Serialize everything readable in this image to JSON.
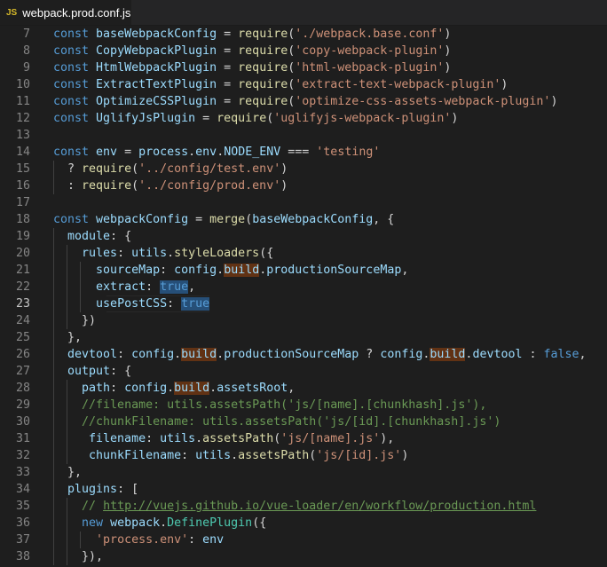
{
  "tab": {
    "icon": "JS",
    "title": "webpack.prod.conf.js"
  },
  "lines": [
    {
      "num": "7",
      "tokens": [
        [
          "kw",
          "const "
        ],
        [
          "var",
          "baseWebpackConfig"
        ],
        [
          "op",
          " = "
        ],
        [
          "fn",
          "require"
        ],
        [
          "op",
          "("
        ],
        [
          "str",
          "'./webpack.base.conf'"
        ],
        [
          "op",
          ")"
        ]
      ]
    },
    {
      "num": "8",
      "tokens": [
        [
          "kw",
          "const "
        ],
        [
          "var",
          "CopyWebpackPlugin"
        ],
        [
          "op",
          " = "
        ],
        [
          "fn",
          "require"
        ],
        [
          "op",
          "("
        ],
        [
          "str",
          "'copy-webpack-plugin'"
        ],
        [
          "op",
          ")"
        ]
      ]
    },
    {
      "num": "9",
      "tokens": [
        [
          "kw",
          "const "
        ],
        [
          "var",
          "HtmlWebpackPlugin"
        ],
        [
          "op",
          " = "
        ],
        [
          "fn",
          "require"
        ],
        [
          "op",
          "("
        ],
        [
          "str",
          "'html-webpack-plugin'"
        ],
        [
          "op",
          ")"
        ]
      ]
    },
    {
      "num": "10",
      "tokens": [
        [
          "kw",
          "const "
        ],
        [
          "var",
          "ExtractTextPlugin"
        ],
        [
          "op",
          " = "
        ],
        [
          "fn",
          "require"
        ],
        [
          "op",
          "("
        ],
        [
          "str",
          "'extract-text-webpack-plugin'"
        ],
        [
          "op",
          ")"
        ]
      ]
    },
    {
      "num": "11",
      "tokens": [
        [
          "kw",
          "const "
        ],
        [
          "var",
          "OptimizeCSSPlugin"
        ],
        [
          "op",
          " = "
        ],
        [
          "fn",
          "require"
        ],
        [
          "op",
          "("
        ],
        [
          "str",
          "'optimize-css-assets-webpack-plugin'"
        ],
        [
          "op",
          ")"
        ]
      ]
    },
    {
      "num": "12",
      "tokens": [
        [
          "kw",
          "const "
        ],
        [
          "var",
          "UglifyJsPlugin"
        ],
        [
          "op",
          " = "
        ],
        [
          "fn",
          "require"
        ],
        [
          "op",
          "("
        ],
        [
          "str",
          "'uglifyjs-webpack-plugin'"
        ],
        [
          "op",
          ")"
        ]
      ]
    },
    {
      "num": "13",
      "tokens": []
    },
    {
      "num": "14",
      "tokens": [
        [
          "kw",
          "const "
        ],
        [
          "var",
          "env"
        ],
        [
          "op",
          " = "
        ],
        [
          "var",
          "process"
        ],
        [
          "op",
          "."
        ],
        [
          "var",
          "env"
        ],
        [
          "op",
          "."
        ],
        [
          "var",
          "NODE_ENV"
        ],
        [
          "op",
          " === "
        ],
        [
          "str",
          "'testing'"
        ]
      ]
    },
    {
      "num": "15",
      "tokens": [
        [
          "op",
          "  ? "
        ],
        [
          "fn",
          "require"
        ],
        [
          "op",
          "("
        ],
        [
          "str",
          "'../config/test.env'"
        ],
        [
          "op",
          ")"
        ]
      ]
    },
    {
      "num": "16",
      "tokens": [
        [
          "op",
          "  : "
        ],
        [
          "fn",
          "require"
        ],
        [
          "op",
          "("
        ],
        [
          "str",
          "'../config/prod.env'"
        ],
        [
          "op",
          ")"
        ]
      ]
    },
    {
      "num": "17",
      "tokens": []
    },
    {
      "num": "18",
      "tokens": [
        [
          "kw",
          "const "
        ],
        [
          "var",
          "webpackConfig"
        ],
        [
          "op",
          " = "
        ],
        [
          "fn",
          "merge"
        ],
        [
          "op",
          "("
        ],
        [
          "var",
          "baseWebpackConfig"
        ],
        [
          "op",
          ", {"
        ]
      ]
    },
    {
      "num": "19",
      "tokens": [
        [
          "op",
          "  "
        ],
        [
          "var",
          "module"
        ],
        [
          "op",
          ": {"
        ]
      ]
    },
    {
      "num": "20",
      "tokens": [
        [
          "op",
          "    "
        ],
        [
          "var",
          "rules"
        ],
        [
          "op",
          ": "
        ],
        [
          "var",
          "utils"
        ],
        [
          "op",
          "."
        ],
        [
          "fn",
          "styleLoaders"
        ],
        [
          "op",
          "({"
        ]
      ]
    },
    {
      "num": "21",
      "tokens": [
        [
          "op",
          "      "
        ],
        [
          "var",
          "sourceMap"
        ],
        [
          "op",
          ": "
        ],
        [
          "var",
          "config"
        ],
        [
          "op",
          "."
        ],
        [
          "var hl-build",
          "build"
        ],
        [
          "op",
          "."
        ],
        [
          "var",
          "productionSourceMap"
        ],
        [
          "op",
          ","
        ]
      ]
    },
    {
      "num": "22",
      "tokens": [
        [
          "op",
          "      "
        ],
        [
          "var",
          "extract"
        ],
        [
          "op",
          ": "
        ],
        [
          "kw hl-true",
          "true"
        ],
        [
          "op",
          ","
        ]
      ]
    },
    {
      "num": "23",
      "active": true,
      "tokens": [
        [
          "op",
          "      "
        ],
        [
          "var",
          "usePostCSS"
        ],
        [
          "op",
          ": "
        ],
        [
          "kw hl-true",
          "true"
        ]
      ]
    },
    {
      "num": "24",
      "tokens": [
        [
          "op",
          "    })"
        ]
      ]
    },
    {
      "num": "25",
      "tokens": [
        [
          "op",
          "  },"
        ]
      ]
    },
    {
      "num": "26",
      "tokens": [
        [
          "op",
          "  "
        ],
        [
          "var",
          "devtool"
        ],
        [
          "op",
          ": "
        ],
        [
          "var",
          "config"
        ],
        [
          "op",
          "."
        ],
        [
          "var hl-build",
          "build"
        ],
        [
          "op",
          "."
        ],
        [
          "var",
          "productionSourceMap"
        ],
        [
          "op",
          " ? "
        ],
        [
          "var",
          "config"
        ],
        [
          "op",
          "."
        ],
        [
          "var hl-build",
          "build"
        ],
        [
          "op",
          "."
        ],
        [
          "var",
          "devtool"
        ],
        [
          "op",
          " : "
        ],
        [
          "kw",
          "false"
        ],
        [
          "op",
          ","
        ]
      ]
    },
    {
      "num": "27",
      "tokens": [
        [
          "op",
          "  "
        ],
        [
          "var",
          "output"
        ],
        [
          "op",
          ": {"
        ]
      ]
    },
    {
      "num": "28",
      "tokens": [
        [
          "op",
          "    "
        ],
        [
          "var",
          "path"
        ],
        [
          "op",
          ": "
        ],
        [
          "var",
          "config"
        ],
        [
          "op",
          "."
        ],
        [
          "var hl-build",
          "build"
        ],
        [
          "op",
          "."
        ],
        [
          "var",
          "assetsRoot"
        ],
        [
          "op",
          ","
        ]
      ]
    },
    {
      "num": "29",
      "tokens": [
        [
          "op",
          "    "
        ],
        [
          "com",
          "//filename: utils.assetsPath('js/[name].[chunkhash].js'),"
        ]
      ]
    },
    {
      "num": "30",
      "tokens": [
        [
          "op",
          "    "
        ],
        [
          "com",
          "//chunkFilename: utils.assetsPath('js/[id].[chunkhash].js')"
        ]
      ]
    },
    {
      "num": "31",
      "tokens": [
        [
          "op",
          "     "
        ],
        [
          "var",
          "filename"
        ],
        [
          "op",
          ": "
        ],
        [
          "var",
          "utils"
        ],
        [
          "op",
          "."
        ],
        [
          "fn",
          "assetsPath"
        ],
        [
          "op",
          "("
        ],
        [
          "str",
          "'js/[name].js'"
        ],
        [
          "op",
          "),"
        ]
      ]
    },
    {
      "num": "32",
      "tokens": [
        [
          "op",
          "     "
        ],
        [
          "var",
          "chunkFilename"
        ],
        [
          "op",
          ": "
        ],
        [
          "var",
          "utils"
        ],
        [
          "op",
          "."
        ],
        [
          "fn",
          "assetsPath"
        ],
        [
          "op",
          "("
        ],
        [
          "str",
          "'js/[id].js'"
        ],
        [
          "op",
          ")"
        ]
      ]
    },
    {
      "num": "33",
      "tokens": [
        [
          "op",
          "  },"
        ]
      ]
    },
    {
      "num": "34",
      "tokens": [
        [
          "op",
          "  "
        ],
        [
          "var",
          "plugins"
        ],
        [
          "op",
          ": ["
        ]
      ]
    },
    {
      "num": "35",
      "tokens": [
        [
          "op",
          "    "
        ],
        [
          "com",
          "// "
        ],
        [
          "link",
          "http://vuejs.github.io/vue-loader/en/workflow/production.html"
        ]
      ]
    },
    {
      "num": "36",
      "tokens": [
        [
          "op",
          "    "
        ],
        [
          "kw",
          "new "
        ],
        [
          "var",
          "webpack"
        ],
        [
          "op",
          "."
        ],
        [
          "cls",
          "DefinePlugin"
        ],
        [
          "op",
          "({"
        ]
      ]
    },
    {
      "num": "37",
      "tokens": [
        [
          "op",
          "      "
        ],
        [
          "str",
          "'process.env'"
        ],
        [
          "op",
          ": "
        ],
        [
          "var",
          "env"
        ]
      ]
    },
    {
      "num": "38",
      "tokens": [
        [
          "op",
          "    }),"
        ]
      ]
    }
  ]
}
